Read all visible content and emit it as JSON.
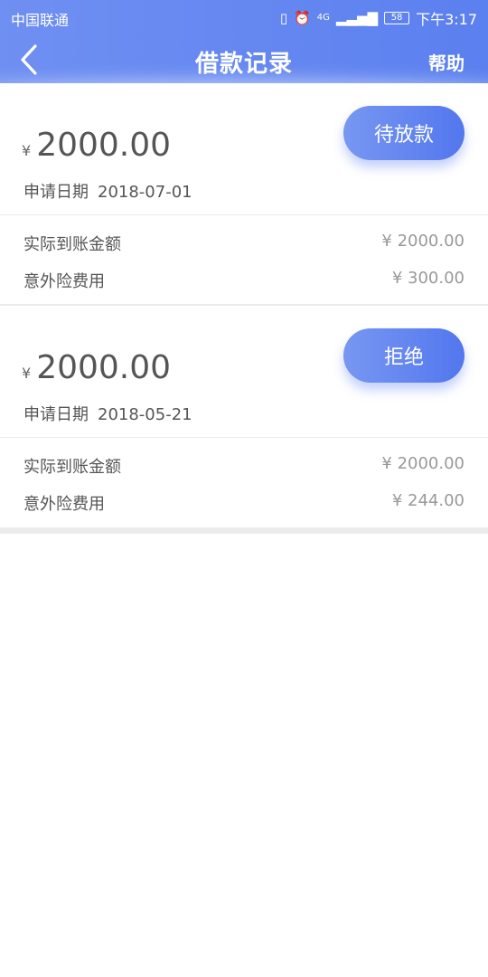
{
  "status_bar": {
    "carrier": "中国联通",
    "network": "4G",
    "battery": "58",
    "time": "下午3:17"
  },
  "nav": {
    "title": "借款记录",
    "help": "帮助"
  },
  "records": [
    {
      "currency": "¥",
      "amount": "2000.00",
      "date_label": "申请日期",
      "date": "2018-07-01",
      "status": "待放款",
      "received_label": "实际到账金额",
      "received_value": "¥ 2000.00",
      "insurance_label": "意外险费用",
      "insurance_value": "¥ 300.00"
    },
    {
      "currency": "¥",
      "amount": "2000.00",
      "date_label": "申请日期",
      "date": "2018-05-21",
      "status": "拒绝",
      "received_label": "实际到账金额",
      "received_value": "¥ 2000.00",
      "insurance_label": "意外险费用",
      "insurance_value": "¥ 244.00"
    }
  ]
}
